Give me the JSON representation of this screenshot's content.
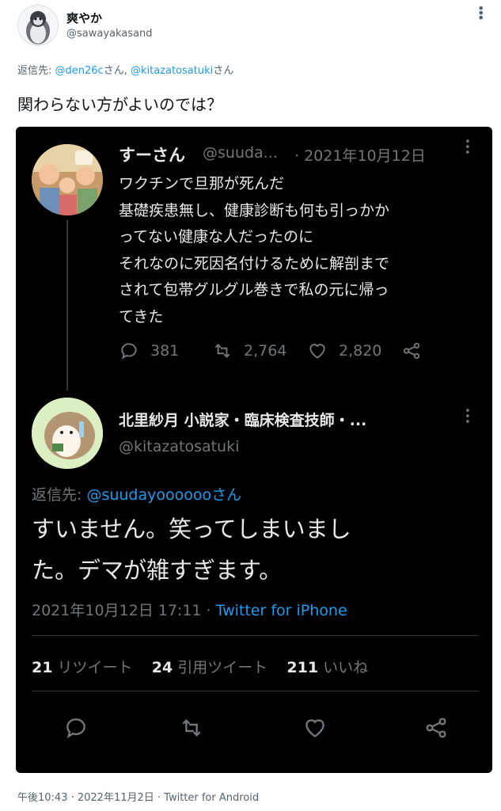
{
  "outer_tweet": {
    "author_name": "爽やか",
    "author_handle": "@sawayakasand",
    "reply_prefix": "返信先: ",
    "reply_handle_1": "@den26c",
    "reply_suffix_1": "さん, ",
    "reply_handle_2": "@kitazatosatuki",
    "reply_suffix_2": "さん",
    "text": "関わらない方がよいのでは？",
    "footer": "午後10:43 · 2022年11月2日 · Twitter for Android"
  },
  "embedded": {
    "first_tweet": {
      "name": "すーさん",
      "handle": "@suuda...",
      "date": "· 2021年10月12日",
      "lines": [
        "ワクチンで旦那が死んだ",
        "基礎疾患無し、健康診断も何も引っかか",
        "ってない健康な人だったのに",
        "それなのに死因名付けるために解剖まで",
        "されて包帯グルグル巻きで私の元に帰っ",
        "てきた"
      ],
      "replies": "381",
      "retweets": "2,764",
      "likes": "2,820"
    },
    "main_tweet": {
      "name": "北里紗月 小説家・臨床検査技師・...",
      "handle": "@kitazatosatuki",
      "reply_prefix": "返信先: ",
      "reply_handle": "@suudayoooooo",
      "reply_suffix": "さん",
      "line1": "すいません。笑ってしまいまし",
      "line2": "た。デマが雑すぎます。",
      "timestamp": "2021年10月12日 17:11 · ",
      "source": "Twitter for iPhone",
      "retweet_count": "21",
      "retweet_label": "リツイート",
      "quote_count": "24",
      "quote_label": "引用ツイート",
      "like_count": "211",
      "like_label": "いいね"
    }
  },
  "colors": {
    "link": "#1d9bf0",
    "muted": "#536471",
    "dark_bg": "#000000",
    "dark_text": "#e7e9ea"
  },
  "icons": [
    "more-icon",
    "reply-icon",
    "retweet-icon",
    "like-icon",
    "share-icon"
  ]
}
